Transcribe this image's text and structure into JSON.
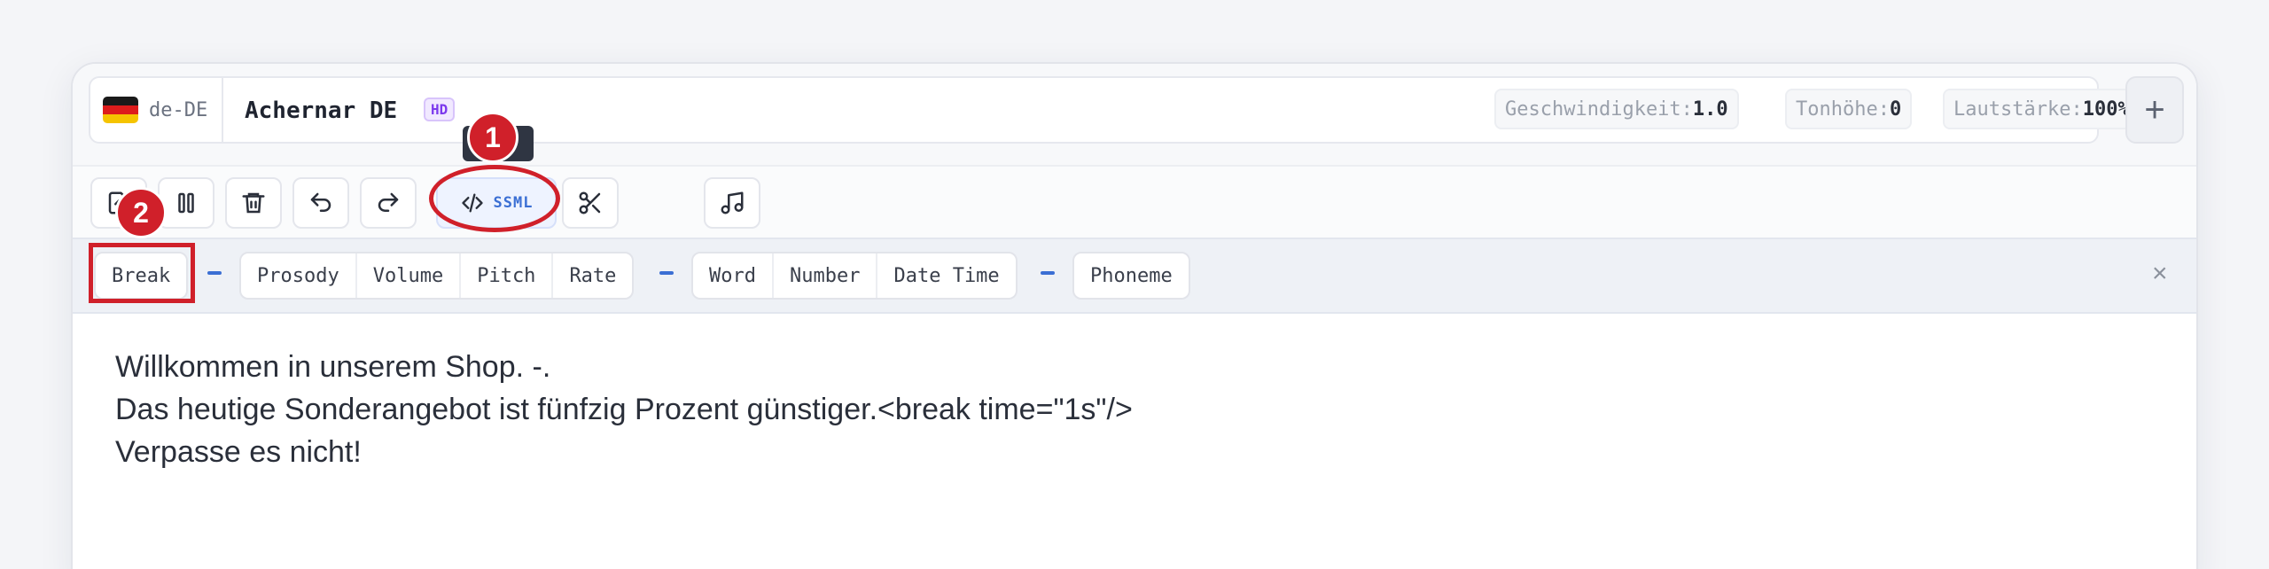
{
  "voice": {
    "locale": "de-DE",
    "flag_colors": [
      "#1a1a1a",
      "#dd1c1c",
      "#f5c400"
    ],
    "name": "Achernar DE",
    "badge": "HD"
  },
  "params": [
    {
      "label": "Geschwindigkeit:",
      "value": "1.0"
    },
    {
      "label": "Tonhöhe:",
      "value": "0"
    },
    {
      "label": "Lautstärke:",
      "value": "100%"
    }
  ],
  "header": {
    "add_icon": "plus-icon",
    "add_label": "+"
  },
  "toolbar": {
    "buttons": [
      {
        "name": "export-icon"
      },
      {
        "name": "pause-icon"
      },
      {
        "name": "trash-icon"
      },
      {
        "name": "undo-icon"
      },
      {
        "name": "redo-icon"
      }
    ],
    "ssml_label": "SSML",
    "scissors": "scissors-icon",
    "music": "music-note-icon"
  },
  "annotations": {
    "step1": "1",
    "step2": "2"
  },
  "tags": {
    "group1": [
      "Break"
    ],
    "group2": [
      "Prosody",
      "Volume",
      "Pitch",
      "Rate"
    ],
    "group3": [
      "Word",
      "Number",
      "Date Time"
    ],
    "group4": [
      "Phoneme"
    ],
    "close": "×"
  },
  "editor": {
    "lines": [
      "Willkommen in unserem Shop. -.",
      "Das heutige Sonderangebot ist fünfzig Prozent günstiger.<break time=\"1s\"/>",
      "Verpasse es nicht!"
    ]
  },
  "colors": {
    "accent": "#3b6fd4",
    "annotation": "#d0202a",
    "hd": "#7c3aed"
  }
}
